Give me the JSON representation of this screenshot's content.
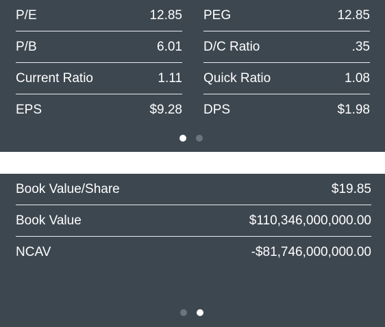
{
  "panel1": {
    "rows": [
      {
        "left_label": "P/E",
        "left_value": "12.85",
        "right_label": "PEG",
        "right_value": "12.85"
      },
      {
        "left_label": "P/B",
        "left_value": "6.01",
        "right_label": "D/C Ratio",
        "right_value": ".35"
      },
      {
        "left_label": "Current Ratio",
        "left_value": "1.11",
        "right_label": "Quick Ratio",
        "right_value": "1.08"
      },
      {
        "left_label": "EPS",
        "left_value": "$9.28",
        "right_label": "DPS",
        "right_value": "$1.98"
      }
    ],
    "page_indicator": {
      "active_page": 1,
      "page_count": 2
    }
  },
  "panel2": {
    "rows": [
      {
        "label": "Book Value/Share",
        "value": "$19.85"
      },
      {
        "label": "Book Value",
        "value": "$110,346,000,000.00"
      },
      {
        "label": "NCAV",
        "value": "-$81,746,000,000.00"
      }
    ],
    "page_indicator": {
      "active_page": 2,
      "page_count": 2
    }
  },
  "colors": {
    "panel_background": "#3d4750",
    "text": "#ffffff",
    "divider": "#e9eef2",
    "dot_active": "#ffffff",
    "dot_inactive": "#6b757d",
    "page_background": "#ffffff"
  }
}
